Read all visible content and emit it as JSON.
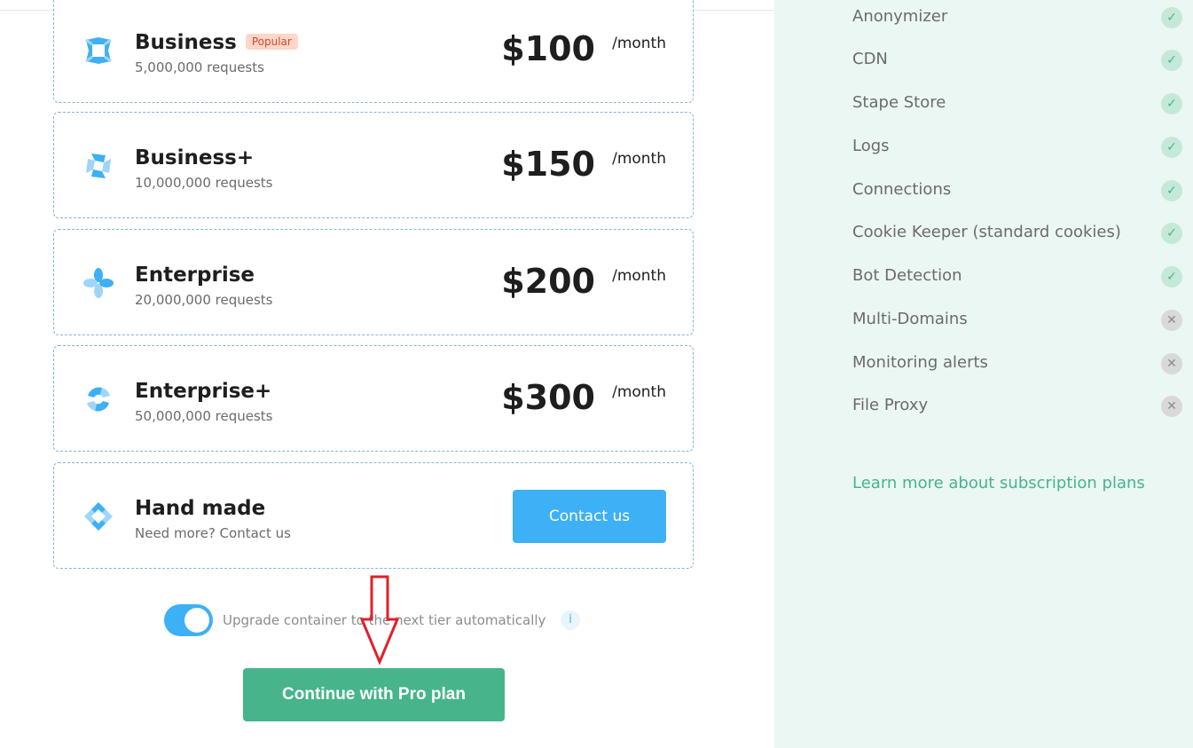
{
  "plans": [
    {
      "name": "Business",
      "badge": "Popular",
      "requests": "5,000,000 requests",
      "price": "$100",
      "per": "/month"
    },
    {
      "name": "Business+",
      "requests": "10,000,000 requests",
      "price": "$150",
      "per": "/month"
    },
    {
      "name": "Enterprise",
      "requests": "20,000,000 requests",
      "price": "$200",
      "per": "/month"
    },
    {
      "name": "Enterprise+",
      "requests": "50,000,000 requests",
      "price": "$300",
      "per": "/month"
    },
    {
      "name": "Hand made",
      "requests": "Need more? Contact us",
      "button": "Contact us"
    }
  ],
  "toggle": {
    "label": "Upgrade container to the next tier automatically",
    "checked": true,
    "info": "i"
  },
  "continue_button": "Continue with Pro plan",
  "features": [
    {
      "label": "Anonymizer",
      "included": true
    },
    {
      "label": "CDN",
      "included": true
    },
    {
      "label": "Stape Store",
      "included": true
    },
    {
      "label": "Logs",
      "included": true
    },
    {
      "label": "Connections",
      "included": true
    },
    {
      "label": "Cookie Keeper (standard cookies)",
      "included": true
    },
    {
      "label": "Bot Detection",
      "included": true
    },
    {
      "label": "Multi-Domains",
      "included": false
    },
    {
      "label": "Monitoring alerts",
      "included": false
    },
    {
      "label": "File Proxy",
      "included": false
    }
  ],
  "learn_more": "Learn more about subscription plans",
  "colors": {
    "accent_blue": "#3eb0f5",
    "accent_green": "#47b48b",
    "panel_bg": "#ebf7f3",
    "annotation_red": "#e0202a"
  }
}
